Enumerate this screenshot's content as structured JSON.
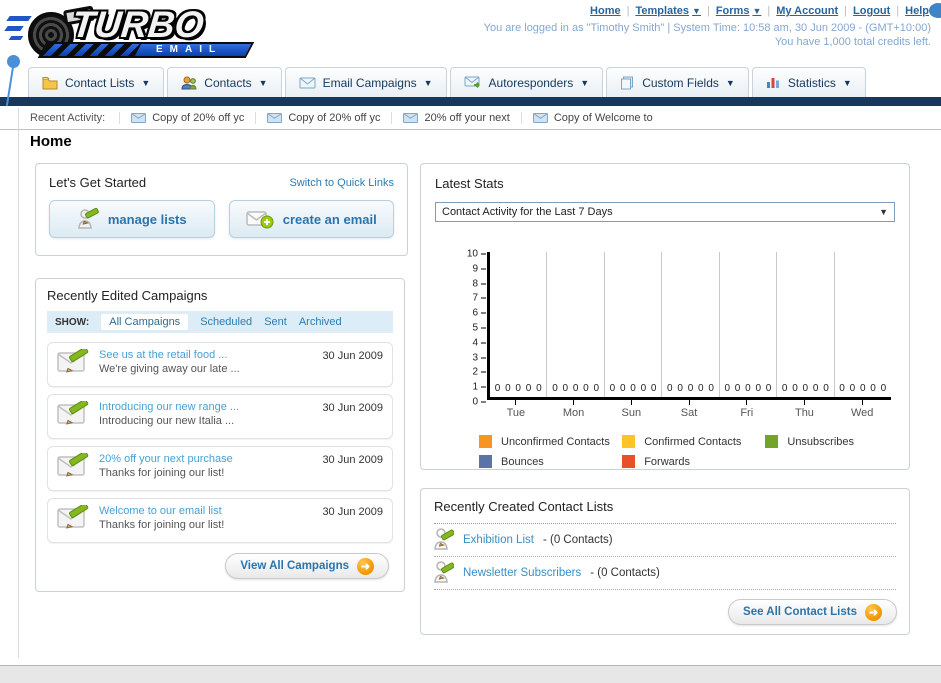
{
  "colors": {
    "navy_bar": "#17375d",
    "link_blue": "#26659e",
    "light_blue_text": "#86a7cf",
    "accent_button_text": "#2a74ad"
  },
  "header": {
    "logo": {
      "title": "TURBO",
      "subtitle": "EMAIL"
    },
    "links": [
      {
        "label": "Home"
      },
      {
        "label": "Templates"
      },
      {
        "label": "Forms"
      },
      {
        "label": "My Account"
      },
      {
        "label": "Logout"
      },
      {
        "label": "Help"
      }
    ],
    "login_info": "You are logged in as \"Timothy Smith\" | System Time: 10:58 am, 30 Jun 2009 - (GMT+10:00)",
    "credits": "You have 1,000 total credits left."
  },
  "nav": {
    "tabs": [
      {
        "label": "Contact Lists",
        "icon": "folder-icon"
      },
      {
        "label": "Contacts",
        "icon": "contacts-icon"
      },
      {
        "label": "Email Campaigns",
        "icon": "envelope-icon"
      },
      {
        "label": "Autoresponders",
        "icon": "autoresponder-icon"
      },
      {
        "label": "Custom Fields",
        "icon": "custom-fields-icon"
      },
      {
        "label": "Statistics",
        "icon": "statistics-icon"
      }
    ]
  },
  "recent_activity": {
    "label": "Recent Activity:",
    "items": [
      {
        "label": "Copy of 20% off yc"
      },
      {
        "label": "Copy of 20% off yc"
      },
      {
        "label": "20% off your next"
      },
      {
        "label": "Copy of Welcome to"
      }
    ]
  },
  "page_title": "Home",
  "get_started": {
    "title": "Let's Get Started",
    "switch_link": "Switch to Quick Links",
    "buttons": [
      {
        "label": "manage lists"
      },
      {
        "label": "create an email"
      }
    ]
  },
  "campaigns": {
    "title": "Recently Edited Campaigns",
    "show_label": "SHOW:",
    "filters": [
      {
        "label": "All Campaigns",
        "active": true
      },
      {
        "label": "Scheduled",
        "active": false
      },
      {
        "label": "Sent",
        "active": false
      },
      {
        "label": "Archived",
        "active": false
      }
    ],
    "items": [
      {
        "title": "See us at the retail food ...",
        "subtitle": "We're giving away our late ...",
        "date": "30 Jun 2009"
      },
      {
        "title": "Introducing our new range ...",
        "subtitle": "Introducing our new Italia ...",
        "date": "30 Jun 2009"
      },
      {
        "title": "20% off your next purchase",
        "subtitle": "Thanks for joining our list!",
        "date": "30 Jun 2009"
      },
      {
        "title": "Welcome to our email list",
        "subtitle": "Thanks for joining our list!",
        "date": "30 Jun 2009"
      }
    ],
    "view_all_label": "View All Campaigns"
  },
  "stats": {
    "title": "Latest Stats",
    "dropdown_value": "Contact Activity for the Last 7 Days",
    "chart_data": {
      "type": "bar",
      "title": "Contact Activity for the Last 7 Days",
      "categories": [
        "Tue",
        "Mon",
        "Sun",
        "Sat",
        "Fri",
        "Thu",
        "Wed"
      ],
      "series": [
        {
          "name": "Unconfirmed Contacts",
          "color": "#f79422",
          "values": [
            0,
            0,
            0,
            0,
            0,
            0,
            0
          ]
        },
        {
          "name": "Confirmed Contacts",
          "color": "#fcc428",
          "values": [
            0,
            0,
            0,
            0,
            0,
            0,
            0
          ]
        },
        {
          "name": "Unsubscribes",
          "color": "#74a32a",
          "values": [
            0,
            0,
            0,
            0,
            0,
            0,
            0
          ]
        },
        {
          "name": "Bounces",
          "color": "#5b73a7",
          "values": [
            0,
            0,
            0,
            0,
            0,
            0,
            0
          ]
        },
        {
          "name": "Forwards",
          "color": "#e8502a",
          "values": [
            0,
            0,
            0,
            0,
            0,
            0,
            0
          ]
        }
      ],
      "ylim": [
        0,
        10
      ],
      "yticks": [
        0,
        1,
        2,
        3,
        4,
        5,
        6,
        7,
        8,
        9,
        10
      ],
      "grid": "vertical-only",
      "legend_position": "bottom"
    }
  },
  "contact_lists": {
    "title": "Recently Created Contact Lists",
    "items": [
      {
        "name": "Exhibition List",
        "suffix": " - (0 Contacts)"
      },
      {
        "name": "Newsletter Subscribers",
        "suffix": " - (0 Contacts)"
      }
    ],
    "see_all_label": "See All Contact Lists"
  }
}
